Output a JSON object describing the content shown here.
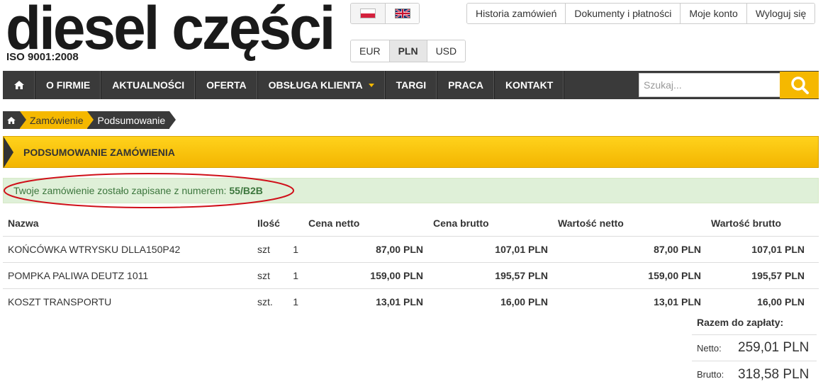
{
  "brand": {
    "name": "diesel części",
    "certification": "ISO 9001:2008"
  },
  "languages": [
    "polish-flag",
    "uk-flag"
  ],
  "currencies": [
    {
      "code": "EUR",
      "active": false
    },
    {
      "code": "PLN",
      "active": true
    },
    {
      "code": "USD",
      "active": false
    }
  ],
  "user_nav": [
    "Historia zamówień",
    "Dokumenty i płatności",
    "Moje konto",
    "Wyloguj się"
  ],
  "main_nav": [
    "O FIRMIE",
    "AKTUALNOŚCI",
    "OFERTA",
    "OBSŁUGA KLIENTA",
    "TARGI",
    "PRACA",
    "KONTAKT"
  ],
  "search": {
    "placeholder": "Szukaj..."
  },
  "breadcrumb": [
    "Zamówienie",
    "Podsumowanie"
  ],
  "page_title": "PODSUMOWANIE ZAMÓWIENIA",
  "alert": {
    "text": "Twoje zamówienie zostało zapisane z numerem:",
    "order_number": "55/B2B"
  },
  "table": {
    "headers": [
      "Nazwa",
      "Ilość",
      "Cena netto",
      "Cena brutto",
      "Wartość netto",
      "Wartość brutto"
    ],
    "rows": [
      {
        "name": "KOŃCÓWKA WTRYSKU DLLA150P42",
        "unit": "szt",
        "qty": "1",
        "price_net": "87,00 PLN",
        "price_gross": "107,01 PLN",
        "value_net": "87,00 PLN",
        "value_gross": "107,01 PLN"
      },
      {
        "name": "POMPKA PALIWA DEUTZ 1011",
        "unit": "szt",
        "qty": "1",
        "price_net": "159,00 PLN",
        "price_gross": "195,57 PLN",
        "value_net": "159,00 PLN",
        "value_gross": "195,57 PLN"
      },
      {
        "name": "KOSZT TRANSPORTU",
        "unit": "szt.",
        "qty": "1",
        "price_net": "13,01 PLN",
        "price_gross": "16,00 PLN",
        "value_net": "13,01 PLN",
        "value_gross": "16,00 PLN"
      }
    ]
  },
  "totals": {
    "title": "Razem do zapłaty:",
    "net_label": "Netto:",
    "net_value": "259,01 PLN",
    "gross_label": "Brutto:",
    "gross_value": "318,58 PLN"
  },
  "colors": {
    "accent": "#f5b800",
    "nav_bg": "#3a3a3a",
    "success_bg": "#dff0d8",
    "success_text": "#3c763d",
    "highlight_ellipse": "#d0101a"
  }
}
